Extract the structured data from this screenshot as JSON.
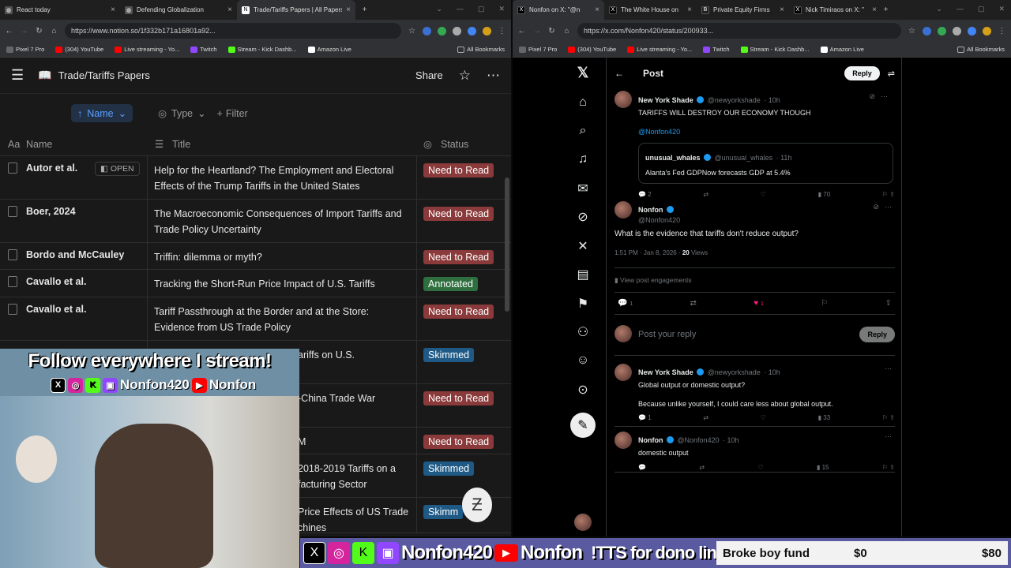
{
  "left_browser": {
    "tabs": [
      {
        "title": "React today",
        "favicon": "globe-icon"
      },
      {
        "title": "Defending Globalization",
        "favicon": "globe-icon"
      },
      {
        "title": "Trade/Tariffs Papers | All Papers",
        "favicon": "notion-icon"
      }
    ],
    "url": "https://www.notion.so/1f332b171a16801a92...",
    "bookmarks": [
      "Pixel 7 Pro",
      "(304) YouTube",
      "Live streaming - Yo...",
      "Twitch",
      "Stream - Kick Dashb...",
      "Amazon Live"
    ],
    "bookmarks_more": "All Bookmarks"
  },
  "notion": {
    "page_title": "Trade/Tariffs Papers",
    "share_label": "Share",
    "sort_chip": "Name",
    "type_filter": "Type",
    "filter_label": "Filter",
    "columns": {
      "name": "Name",
      "title": "Title",
      "status": "Status"
    },
    "open_label": "OPEN",
    "rows": [
      {
        "name": "Autor et al.",
        "title": "Help for the Heartland? The Employment and Electoral Effects of the Trump Tariffs in the United States",
        "status": "Need to Read"
      },
      {
        "name": "Boer, 2024",
        "title": "The Macroeconomic Consequences of Import Tariffs and Trade Policy Uncertainty",
        "status": "Need to Read"
      },
      {
        "name": "Bordo and McCauley",
        "title": "Triffin: dilemma or myth?",
        "status": "Need to Read"
      },
      {
        "name": "Cavallo et al.",
        "title": "Tracking the Short-Run Price Impact of U.S. Tariffs",
        "status": "Annotated"
      },
      {
        "name": "Cavallo et al.",
        "title": "Tariff Passthrough at the Border and at the Store: Evidence from US Trade Policy",
        "status": "Need to Read"
      },
      {
        "name": "",
        "title": "ariffs on U.S.",
        "status": "Skimmed"
      },
      {
        "name": "",
        "title": "-China Trade War",
        "status": "Need to Read"
      },
      {
        "name": "",
        "title": "M",
        "status": "Need to Read"
      },
      {
        "name": "",
        "title": "2018-2019 Tariffs on a facturing Sector",
        "status": "Skimmed"
      },
      {
        "name": "",
        "title": "Price Effects of US Trade chines",
        "status": "Skimm"
      }
    ]
  },
  "overlay": {
    "headline": "Follow everywhere I stream!",
    "handle_main": "Nonfon420",
    "handle_youtube": "Nonfon"
  },
  "bottom_bar": {
    "handle_main": "Nonfon420",
    "handle_youtube": "Nonfon",
    "tts": "!TTS for dono link",
    "fund_label": "Broke boy fund",
    "fund_current": "$0",
    "fund_goal": "$80",
    "fund_progress": 0
  },
  "right_browser": {
    "tabs": [
      {
        "title": "Nonfon on X: \"@n",
        "favicon": "x-icon"
      },
      {
        "title": "The White House on",
        "favicon": "x-icon"
      },
      {
        "title": "Private Equity Firms",
        "favicon": "b-icon"
      },
      {
        "title": "Nick Timiraos on X: \"",
        "favicon": "x-icon"
      }
    ],
    "url": "https://x.com/Nonfon420/status/200933...",
    "bookmarks": [
      "Pixel 7 Pro",
      "(304) YouTube",
      "Live streaming - Yo...",
      "Twitch",
      "Stream - Kick Dashb...",
      "Amazon Live"
    ],
    "bookmarks_more": "All Bookmarks"
  },
  "twitter": {
    "header_title": "Post",
    "reply_button": "Reply",
    "parent_tweet": {
      "name": "New York Shade",
      "handle": "@newyorkshade",
      "time": "10h",
      "text": "TARIFFS WILL DESTROY OUR ECONOMY THOUGH",
      "mention": "@Nonfon420",
      "quote": {
        "name": "unusual_whales",
        "handle": "@unusual_whales",
        "time": "11h",
        "text": "Alanta's Fed GDPNow forecasts GDP at 5.4%"
      },
      "replies": "2",
      "views": "70"
    },
    "main_tweet": {
      "name": "Nonfon",
      "handle": "@Nonfon420",
      "text": "What is the evidence that tariffs don't reduce output?",
      "timestamp": "1:51 PM · Jan 8, 2026 · ",
      "views_count": "20",
      "views_label": " Views",
      "engagements": "View post engagements",
      "replies": "1",
      "likes": "1"
    },
    "reply_placeholder": "Post your reply",
    "reply_submit": "Reply",
    "replies": [
      {
        "name": "New York Shade",
        "handle": "@newyorkshade",
        "time": "10h",
        "line1": "Global output or domestic output?",
        "line2": "Because unlike yourself, I could care less about global output.",
        "replies": "1",
        "views": "33"
      },
      {
        "name": "Nonfon",
        "handle": "@Nonfon420",
        "time": "10h",
        "line1": "domestic output",
        "views": "15"
      }
    ]
  },
  "colors": {
    "accent_blue": "#1d9bf0",
    "need_to_read": "#8a3a3a",
    "annotated": "#2f6f3f",
    "skimmed": "#1f5a86"
  }
}
